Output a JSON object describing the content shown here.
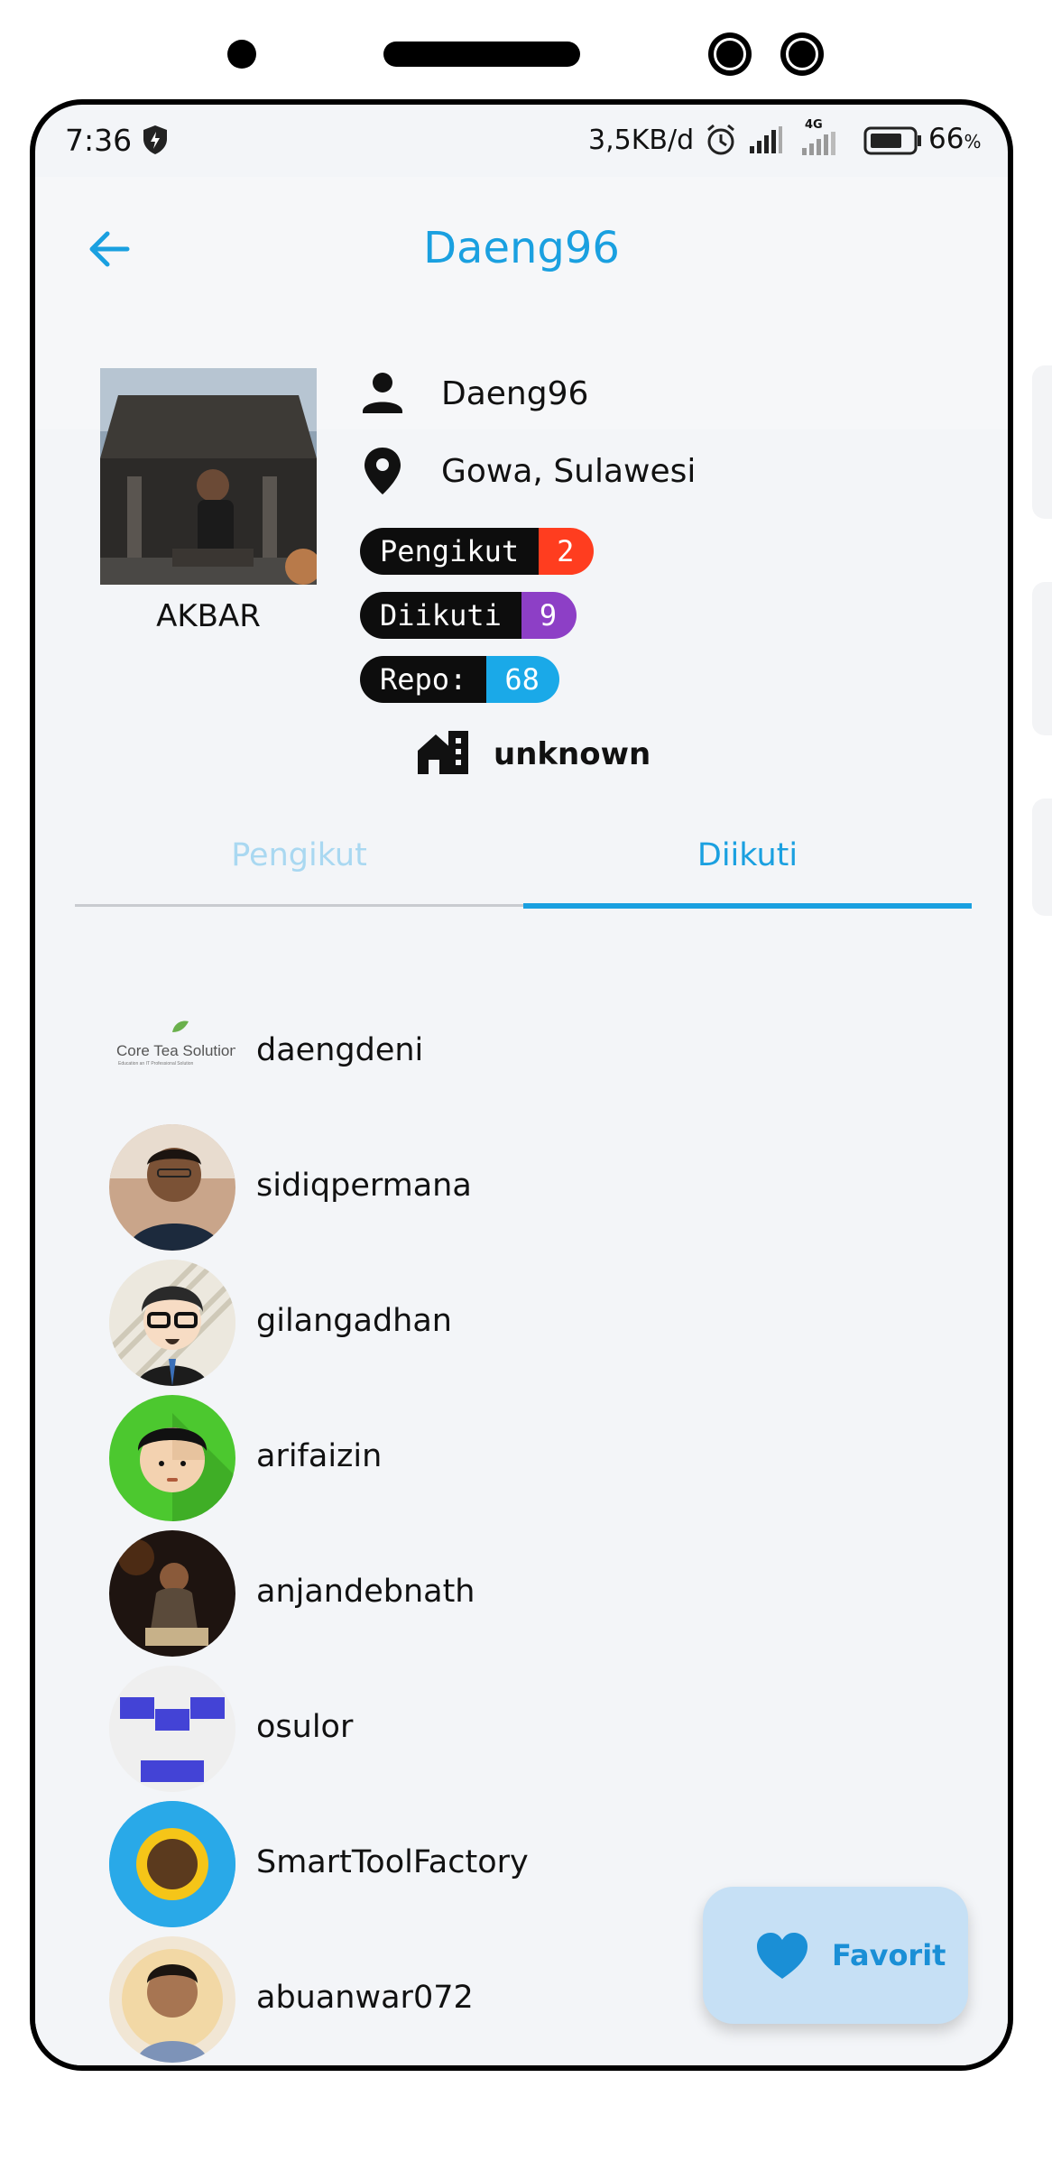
{
  "status_bar": {
    "time": "7:36",
    "net_speed": "3,5KB/d",
    "network_type": "4G",
    "battery": "66",
    "battery_unit": "%"
  },
  "appbar": {
    "title": "Daeng96"
  },
  "profile": {
    "display_name": "AKBAR",
    "username": "Daeng96",
    "location": "Gowa, Sulawesi",
    "company": "unknown"
  },
  "badges": {
    "followers_label": "Pengikut",
    "followers_value": "2",
    "following_label": "Diikuti",
    "following_value": "9",
    "repo_label": "Repo:",
    "repo_value": "68"
  },
  "tabs": {
    "followers": "Pengikut",
    "following": "Diikuti",
    "active": "following"
  },
  "following_list": [
    {
      "login": "daengdeni",
      "avatar": "coretea-solution-logo",
      "logo_text": "Core Tea Solution",
      "logo_tagline": "Education an IT Professional Solution"
    },
    {
      "login": "sidiqpermana",
      "avatar": "photo-smiling-man"
    },
    {
      "login": "gilangadhan",
      "avatar": "cartoon-man-glasses"
    },
    {
      "login": "arifaizin",
      "avatar": "cartoon-face-green"
    },
    {
      "login": "anjandebnath",
      "avatar": "photo-man-sitting"
    },
    {
      "login": "osulor",
      "avatar": "identicon-blue"
    },
    {
      "login": "SmartToolFactory",
      "avatar": "sunflower-blue"
    },
    {
      "login": "abuanwar072",
      "avatar": "photo-man-portrait"
    },
    {
      "login": "",
      "avatar": "photo-partial"
    }
  ],
  "fab": {
    "label": "Favorit"
  },
  "colors": {
    "accent": "#1aa0e0",
    "tab_inactive": "#a9d8f1",
    "followers_badge": "#ff3d1f",
    "following_badge": "#8d3fc6",
    "repo_badge": "#1aa9e8",
    "fab_bg": "#c6e0f5"
  }
}
